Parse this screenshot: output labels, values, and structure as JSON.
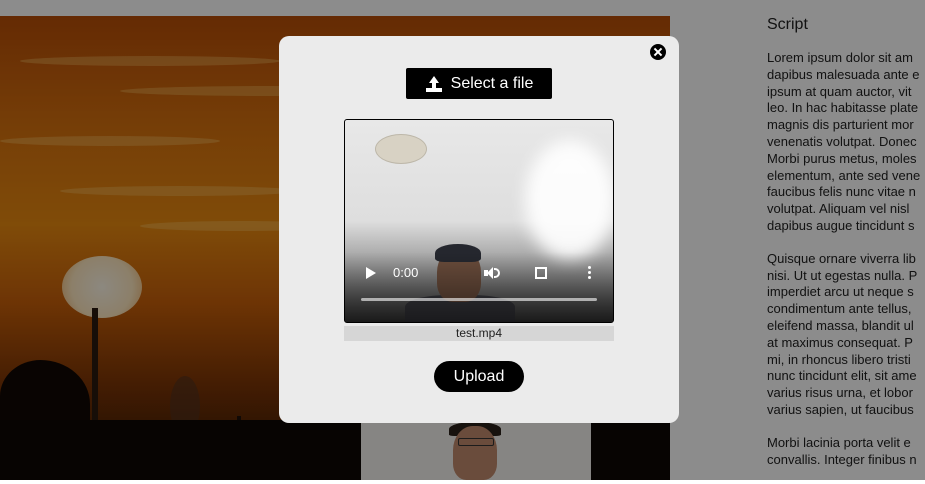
{
  "sidebar": {
    "title": "Script",
    "paragraphs": [
      [
        "Lorem ipsum dolor sit am",
        "dapibus malesuada ante e",
        "ipsum at quam auctor, vit",
        "leo. In hac habitasse plate",
        "magnis dis parturient mor",
        "venenatis volutpat. Donec",
        "Morbi purus metus, moles",
        "elementum, ante sed vene",
        "faucibus felis nunc vitae n",
        "volutpat. Aliquam vel nisl",
        "dapibus augue tincidunt s"
      ],
      [
        "Quisque ornare viverra lib",
        "nisi. Ut ut egestas nulla. P",
        "imperdiet arcu ut neque s",
        "condimentum ante tellus,",
        "eleifend massa, blandit ul",
        "at maximus consequat. P",
        "mi, in rhoncus libero tristi",
        "nunc tincidunt elit, sit ame",
        "varius risus urna, et lobor",
        "varius sapien, ut faucibus"
      ],
      [
        "Morbi lacinia porta velit e",
        "convallis. Integer finibus n"
      ]
    ]
  },
  "modal": {
    "select_label": "Select a file",
    "video": {
      "time": "0:00",
      "progress": 0
    },
    "filename": "test.mp4",
    "upload_label": "Upload"
  }
}
